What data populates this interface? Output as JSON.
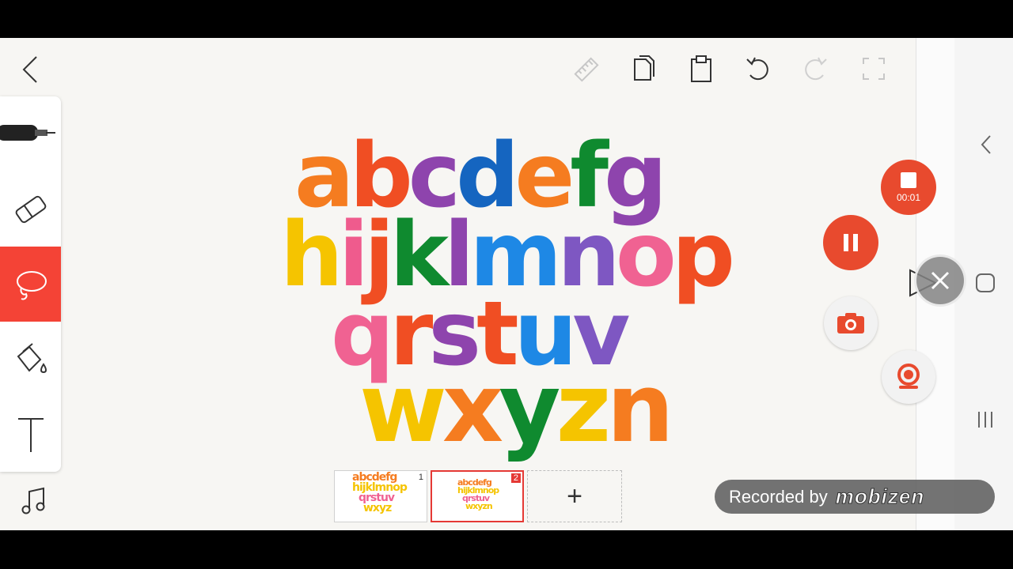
{
  "toolbar": {
    "icons": [
      "back-icon",
      "ruler-icon",
      "copy-icon",
      "paste-icon",
      "undo-icon",
      "redo-icon",
      "fullscreen-icon",
      "more-icon"
    ]
  },
  "tools": [
    "pen",
    "eraser",
    "lasso",
    "fill",
    "text",
    "music"
  ],
  "canvas": {
    "lines": [
      [
        {
          "ch": "a",
          "c": "#f57c20"
        },
        {
          "ch": "b",
          "c": "#f04e23"
        },
        {
          "ch": "c",
          "c": "#8e44ad"
        },
        {
          "ch": "d",
          "c": "#1565c0"
        },
        {
          "ch": "e",
          "c": "#f57c20"
        },
        {
          "ch": "f",
          "c": "#0f8a2f"
        },
        {
          "ch": "g",
          "c": "#8e44ad"
        }
      ],
      [
        {
          "ch": "h",
          "c": "#f5c400"
        },
        {
          "ch": "i",
          "c": "#ef5b8d"
        },
        {
          "ch": "j",
          "c": "#f04e23"
        },
        {
          "ch": "k",
          "c": "#0f8a2f"
        },
        {
          "ch": "l",
          "c": "#8e44ad"
        },
        {
          "ch": "m",
          "c": "#1e88e5"
        },
        {
          "ch": "n",
          "c": "#7e57c2"
        },
        {
          "ch": "o",
          "c": "#f06292"
        },
        {
          "ch": "p",
          "c": "#f04e23"
        }
      ],
      [
        {
          "ch": "q",
          "c": "#f06292"
        },
        {
          "ch": "r",
          "c": "#f04e23"
        },
        {
          "ch": "s",
          "c": "#8e44ad"
        },
        {
          "ch": "t",
          "c": "#f04e23"
        },
        {
          "ch": "u",
          "c": "#1e88e5"
        },
        {
          "ch": "v",
          "c": "#7e57c2"
        }
      ],
      [
        {
          "ch": "w",
          "c": "#f5c400"
        },
        {
          "ch": "x",
          "c": "#f57c20"
        },
        {
          "ch": "y",
          "c": "#0f8a2f"
        },
        {
          "ch": "z",
          "c": "#f5c400"
        },
        {
          "ch": "n",
          "c": "#f57c20"
        }
      ]
    ]
  },
  "pages": [
    {
      "number": "1",
      "lines": [
        "abcdefg",
        "hijklmnop",
        "qrstuv",
        "wxyz"
      ]
    },
    {
      "number": "2",
      "lines": [
        "abcdefg",
        "hijklmnop",
        "qrstuv",
        "wxyzn"
      ]
    }
  ],
  "add_page_label": "+",
  "recorder": {
    "timer": "00:01",
    "accent": "#e84a2e"
  },
  "watermark": {
    "text": "Recorded by",
    "brand": "mobizen"
  }
}
